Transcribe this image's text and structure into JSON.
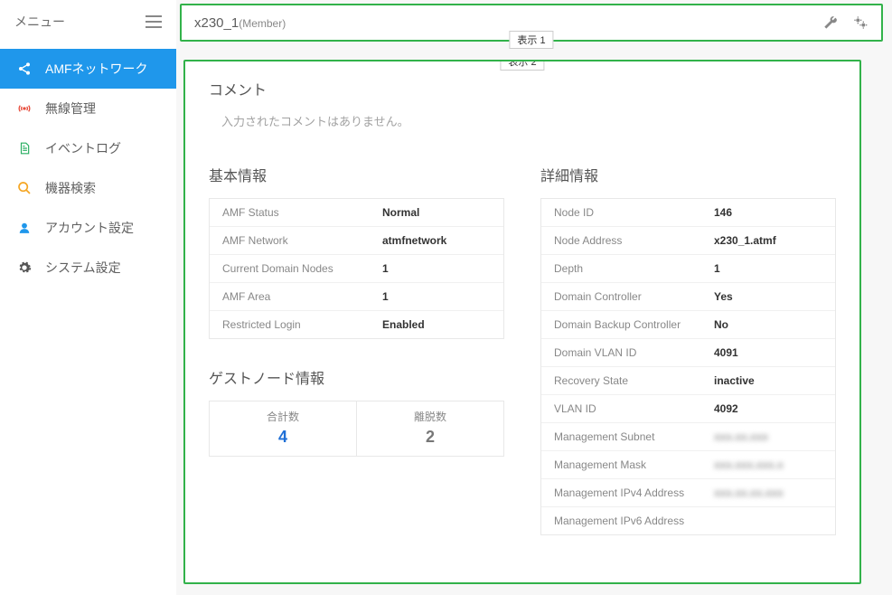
{
  "sidebar": {
    "title": "メニュー",
    "items": [
      {
        "label": "AMFネットワーク"
      },
      {
        "label": "無線管理"
      },
      {
        "label": "イベントログ"
      },
      {
        "label": "機器検索"
      },
      {
        "label": "アカウント設定"
      },
      {
        "label": "システム設定"
      }
    ]
  },
  "header": {
    "node_name": "x230_1",
    "role": "(Member)"
  },
  "frame_tags": {
    "view1": "表示 1",
    "view2": "表示 2"
  },
  "comment": {
    "title": "コメント",
    "empty_text": "入力されたコメントはありません。"
  },
  "basic_info": {
    "title": "基本情報",
    "rows": [
      {
        "label": "AMF Status",
        "value": "Normal"
      },
      {
        "label": "AMF Network",
        "value": "atmfnetwork"
      },
      {
        "label": "Current Domain Nodes",
        "value": "1"
      },
      {
        "label": "AMF Area",
        "value": "1"
      },
      {
        "label": "Restricted Login",
        "value": "Enabled"
      }
    ]
  },
  "guest": {
    "title": "ゲストノード情報",
    "total_label": "合計数",
    "total_value": "4",
    "left_label": "離脱数",
    "left_value": "2"
  },
  "detail_info": {
    "title": "詳細情報",
    "rows": [
      {
        "label": "Node ID",
        "value": "146"
      },
      {
        "label": "Node Address",
        "value": "x230_1.atmf"
      },
      {
        "label": "Depth",
        "value": "1"
      },
      {
        "label": "Domain Controller",
        "value": "Yes"
      },
      {
        "label": "Domain Backup Controller",
        "value": "No"
      },
      {
        "label": "Domain VLAN ID",
        "value": "4091"
      },
      {
        "label": "Recovery State",
        "value": "inactive"
      },
      {
        "label": "VLAN ID",
        "value": "4092"
      },
      {
        "label": "Management Subnet",
        "value": "xxx.xx.xxx",
        "masked": true
      },
      {
        "label": "Management Mask",
        "value": "xxx.xxx.xxx.x",
        "masked": true
      },
      {
        "label": "Management IPv4 Address",
        "value": "xxx.xx.xx.xxx",
        "masked": true
      },
      {
        "label": "Management IPv6 Address",
        "value": ""
      }
    ]
  }
}
